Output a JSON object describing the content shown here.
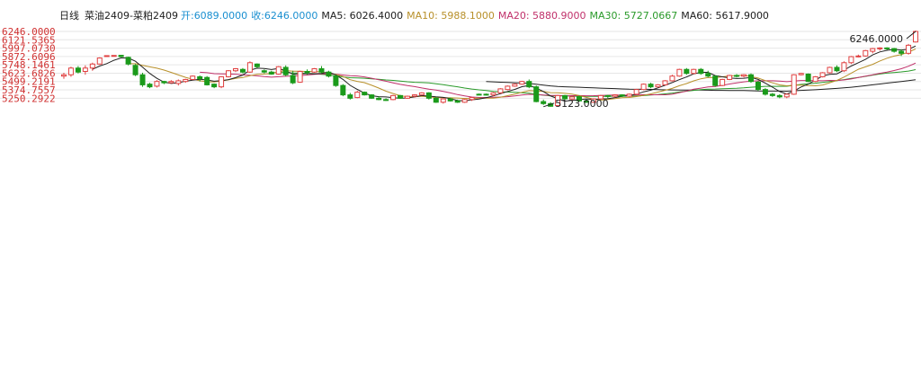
{
  "chart_data": {
    "type": "candlestick",
    "header": {
      "period": "日线",
      "symbol": "菜油2409-菜粕2409",
      "open_label": "开:",
      "open_value": "6089.0000",
      "close_label": "收:",
      "close_value": "6246.0000",
      "ma": [
        {
          "label": "MA5:",
          "value": "6026.4000",
          "color": "#202020"
        },
        {
          "label": "MA10:",
          "value": "5988.1000",
          "color": "#b8902a"
        },
        {
          "label": "MA20:",
          "value": "5880.9000",
          "color": "#c0306a"
        },
        {
          "label": "MA30:",
          "value": "5727.0667",
          "color": "#2a9a2a"
        },
        {
          "label": "MA60:",
          "value": "5617.9000",
          "color": "#202020"
        }
      ]
    },
    "colors": {
      "up": "#e04040",
      "down": "#1a9a1a",
      "header_prices": "#1a8fd0",
      "ticks": "#d03030",
      "grid": "#e6e6e6",
      "ma5": "#202020",
      "ma10": "#b8902a",
      "ma20": "#c0306a",
      "ma30": "#2a9a2a",
      "ma60": "#202020"
    },
    "y_ticks": [
      "6246.0000",
      "6121.5365",
      "5997.0730",
      "5872.6096",
      "5748.1461",
      "5623.6826",
      "5499.2191",
      "5374.7557",
      "5250.2922"
    ],
    "y_tick_values": [
      6246.0,
      6121.5365,
      5997.073,
      5872.6096,
      5748.1461,
      5623.6826,
      5499.2191,
      5374.7557,
      5250.2922
    ],
    "ylim": [
      5120,
      6246
    ],
    "grid": true,
    "annotations": [
      {
        "text": "6246.0000",
        "index": 119,
        "value": 6246
      },
      {
        "text": "5123.0000",
        "index": 67,
        "value": 5123
      }
    ],
    "candles": [
      [
        5580,
        5630,
        5540,
        5600
      ],
      [
        5600,
        5720,
        5570,
        5700
      ],
      [
        5700,
        5730,
        5620,
        5640
      ],
      [
        5650,
        5740,
        5600,
        5700
      ],
      [
        5700,
        5780,
        5660,
        5760
      ],
      [
        5760,
        5860,
        5750,
        5850
      ],
      [
        5880,
        5890,
        5870,
        5885
      ],
      [
        5885,
        5890,
        5880,
        5888
      ],
      [
        5890,
        5895,
        5860,
        5870
      ],
      [
        5860,
        5870,
        5740,
        5760
      ],
      [
        5740,
        5760,
        5580,
        5600
      ],
      [
        5600,
        5630,
        5420,
        5450
      ],
      [
        5460,
        5480,
        5400,
        5420
      ],
      [
        5430,
        5520,
        5410,
        5500
      ],
      [
        5500,
        5510,
        5460,
        5480
      ],
      [
        5480,
        5520,
        5470,
        5500
      ],
      [
        5470,
        5530,
        5440,
        5510
      ],
      [
        5500,
        5540,
        5480,
        5530
      ],
      [
        5530,
        5590,
        5520,
        5580
      ],
      [
        5570,
        5590,
        5500,
        5540
      ],
      [
        5560,
        5580,
        5440,
        5450
      ],
      [
        5460,
        5470,
        5400,
        5420
      ],
      [
        5420,
        5580,
        5400,
        5570
      ],
      [
        5570,
        5670,
        5560,
        5660
      ],
      [
        5660,
        5700,
        5640,
        5690
      ],
      [
        5680,
        5700,
        5620,
        5640
      ],
      [
        5640,
        5800,
        5630,
        5780
      ],
      [
        5760,
        5770,
        5700,
        5720
      ],
      [
        5660,
        5680,
        5620,
        5640
      ],
      [
        5640,
        5660,
        5600,
        5610
      ],
      [
        5610,
        5730,
        5600,
        5720
      ],
      [
        5710,
        5740,
        5580,
        5600
      ],
      [
        5590,
        5660,
        5460,
        5480
      ],
      [
        5490,
        5660,
        5480,
        5650
      ],
      [
        5650,
        5680,
        5600,
        5640
      ],
      [
        5640,
        5700,
        5630,
        5690
      ],
      [
        5690,
        5730,
        5620,
        5640
      ],
      [
        5640,
        5660,
        5560,
        5580
      ],
      [
        5580,
        5600,
        5420,
        5440
      ],
      [
        5440,
        5460,
        5280,
        5300
      ],
      [
        5300,
        5330,
        5230,
        5250
      ],
      [
        5260,
        5360,
        5250,
        5340
      ],
      [
        5340,
        5350,
        5290,
        5300
      ],
      [
        5300,
        5310,
        5240,
        5250
      ],
      [
        5250,
        5280,
        5220,
        5230
      ],
      [
        5230,
        5250,
        5210,
        5225
      ],
      [
        5230,
        5300,
        5220,
        5290
      ],
      [
        5290,
        5300,
        5240,
        5250
      ],
      [
        5250,
        5290,
        5240,
        5280
      ],
      [
        5280,
        5310,
        5260,
        5300
      ],
      [
        5300,
        5340,
        5290,
        5330
      ],
      [
        5330,
        5340,
        5230,
        5250
      ],
      [
        5250,
        5270,
        5180,
        5190
      ],
      [
        5190,
        5250,
        5170,
        5240
      ],
      [
        5240,
        5260,
        5200,
        5210
      ],
      [
        5210,
        5230,
        5180,
        5190
      ],
      [
        5190,
        5240,
        5180,
        5230
      ],
      [
        5230,
        5270,
        5210,
        5260
      ],
      [
        5310,
        5320,
        5300,
        5305
      ],
      [
        5310,
        5320,
        5290,
        5300
      ],
      [
        5300,
        5340,
        5280,
        5330
      ],
      [
        5330,
        5400,
        5320,
        5390
      ],
      [
        5380,
        5440,
        5370,
        5430
      ],
      [
        5430,
        5470,
        5420,
        5460
      ],
      [
        5460,
        5510,
        5450,
        5500
      ],
      [
        5500,
        5530,
        5400,
        5420
      ],
      [
        5420,
        5440,
        5190,
        5200
      ],
      [
        5200,
        5230,
        5150,
        5170
      ],
      [
        5170,
        5190,
        5123,
        5130
      ],
      [
        5140,
        5300,
        5130,
        5290
      ],
      [
        5290,
        5300,
        5220,
        5240
      ],
      [
        5240,
        5280,
        5200,
        5270
      ],
      [
        5270,
        5290,
        5200,
        5210
      ],
      [
        5210,
        5230,
        5180,
        5190
      ],
      [
        5190,
        5250,
        5180,
        5240
      ],
      [
        5240,
        5300,
        5230,
        5290
      ],
      [
        5290,
        5300,
        5250,
        5280
      ],
      [
        5280,
        5310,
        5260,
        5300
      ],
      [
        5300,
        5310,
        5270,
        5280
      ],
      [
        5280,
        5320,
        5270,
        5310
      ],
      [
        5310,
        5390,
        5300,
        5380
      ],
      [
        5380,
        5470,
        5370,
        5460
      ],
      [
        5460,
        5480,
        5400,
        5420
      ],
      [
        5420,
        5460,
        5410,
        5450
      ],
      [
        5450,
        5520,
        5440,
        5510
      ],
      [
        5510,
        5600,
        5500,
        5580
      ],
      [
        5580,
        5690,
        5570,
        5680
      ],
      [
        5680,
        5700,
        5600,
        5620
      ],
      [
        5620,
        5690,
        5610,
        5680
      ],
      [
        5680,
        5700,
        5600,
        5620
      ],
      [
        5620,
        5660,
        5560,
        5580
      ],
      [
        5580,
        5590,
        5420,
        5440
      ],
      [
        5440,
        5540,
        5430,
        5530
      ],
      [
        5530,
        5600,
        5520,
        5590
      ],
      [
        5590,
        5610,
        5560,
        5580
      ],
      [
        5580,
        5610,
        5560,
        5600
      ],
      [
        5600,
        5620,
        5480,
        5500
      ],
      [
        5490,
        5510,
        5360,
        5380
      ],
      [
        5380,
        5400,
        5290,
        5310
      ],
      [
        5310,
        5330,
        5270,
        5290
      ],
      [
        5290,
        5310,
        5250,
        5270
      ],
      [
        5270,
        5320,
        5250,
        5310
      ],
      [
        5310,
        5610,
        5300,
        5600
      ],
      [
        5600,
        5630,
        5590,
        5620
      ],
      [
        5610,
        5620,
        5490,
        5500
      ],
      [
        5500,
        5580,
        5490,
        5570
      ],
      [
        5570,
        5640,
        5560,
        5630
      ],
      [
        5630,
        5720,
        5620,
        5710
      ],
      [
        5710,
        5740,
        5640,
        5660
      ],
      [
        5660,
        5800,
        5640,
        5780
      ],
      [
        5780,
        5880,
        5760,
        5870
      ],
      [
        5870,
        5900,
        5860,
        5880
      ],
      [
        5880,
        5970,
        5870,
        5960
      ],
      [
        5950,
        6000,
        5920,
        5990
      ],
      [
        5990,
        6010,
        5960,
        6000
      ],
      [
        6000,
        6010,
        5970,
        5990
      ],
      [
        5990,
        6000,
        5930,
        5950
      ],
      [
        5950,
        5980,
        5880,
        5920
      ],
      [
        5920,
        6060,
        5900,
        6040
      ],
      [
        6089,
        6260,
        6080,
        6246
      ]
    ]
  }
}
